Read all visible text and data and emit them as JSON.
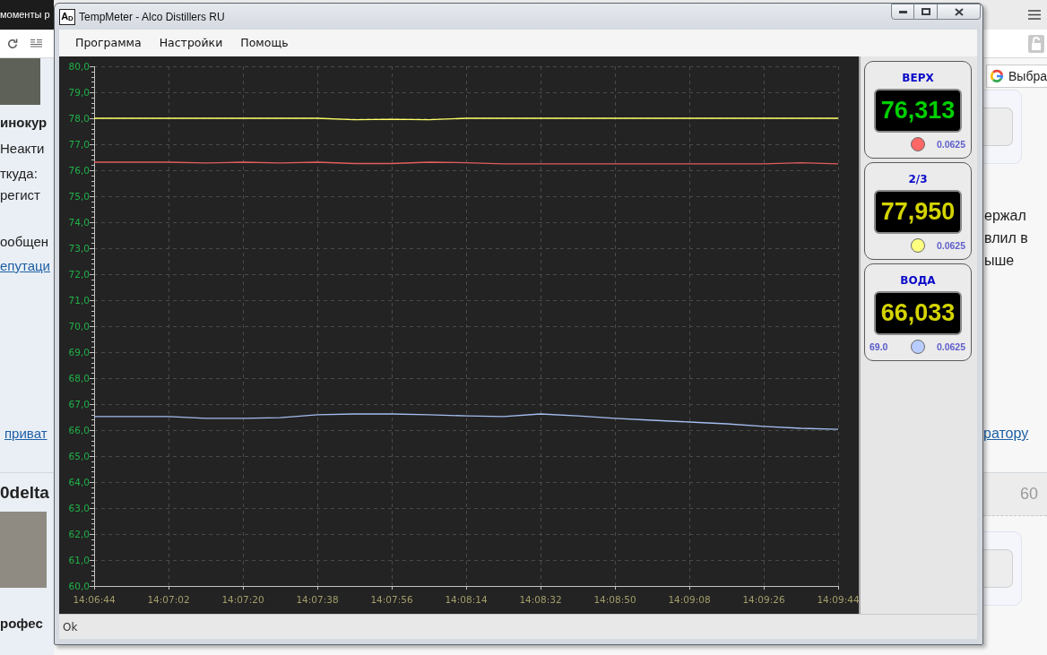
{
  "browser": {
    "tabs": [
      {
        "label": "моменты р",
        "selected": true
      }
    ],
    "translate_box": {
      "label": "Выбра"
    },
    "posts": [
      {
        "author": {
          "rank": "инокур",
          "status": "Неакти",
          "details": [
            "ткуда:",
            "регист"
          ],
          "posts_count": "ообщен",
          "reputation": "епутаци",
          "message_link": "приват"
        },
        "body": {
          "lines": [
            "ержал",
            "влил в",
            "ыше"
          ],
          "link": "ратору"
        }
      },
      {
        "author": {
          "name": "0delta",
          "rank": "рофес"
        },
        "header_number": "60"
      }
    ]
  },
  "window": {
    "icon_text": "A$_{D}$",
    "title": "TempMeter - Alco Distillers RU",
    "menu": [
      "Программа",
      "Настройки",
      "Помощь"
    ],
    "chart_data": {
      "type": "line",
      "grid": true,
      "categories": [
        "14:06:44",
        null,
        "14:07:02",
        null,
        "14:07:20",
        null,
        "14:07:38",
        null,
        "14:07:56",
        null,
        "14:08:14",
        null,
        "14:08:32",
        null,
        "14:08:50",
        null,
        "14:09:08",
        null,
        "14:09:26",
        null,
        "14:09:44"
      ],
      "series": [
        {
          "color": "#ffff66",
          "values": [
            78.0,
            78.0,
            78.0,
            78.0,
            78.0,
            78.0,
            78.0,
            77.94,
            77.96,
            77.94,
            78.0,
            78.0,
            78.0,
            78.0,
            78.0,
            78.0,
            78.0,
            78.0,
            78.0,
            78.0,
            78.0
          ]
        },
        {
          "color": "#e35d5d",
          "values": [
            76.31,
            76.31,
            76.31,
            76.28,
            76.31,
            76.28,
            76.31,
            76.26,
            76.26,
            76.31,
            76.29,
            76.25,
            76.25,
            76.25,
            76.25,
            76.25,
            76.25,
            76.25,
            76.25,
            76.29,
            76.25
          ]
        },
        {
          "color": "#a4bdf0",
          "values": [
            66.52,
            66.52,
            66.52,
            66.45,
            66.45,
            66.48,
            66.59,
            66.62,
            66.62,
            66.59,
            66.55,
            66.52,
            66.62,
            66.55,
            66.45,
            66.38,
            66.31,
            66.24,
            66.14,
            66.07,
            66.03
          ]
        }
      ],
      "ylim": [
        60,
        80
      ],
      "yticks": [
        {
          "value": 60,
          "label": "60,0"
        },
        {
          "value": 61,
          "label": "61,0"
        },
        {
          "value": 62,
          "label": "62,0"
        },
        {
          "value": 63,
          "label": "63,0"
        },
        {
          "value": 64,
          "label": "64,0"
        },
        {
          "value": 65,
          "label": "65,0"
        },
        {
          "value": 66,
          "label": "66,0"
        },
        {
          "value": 67,
          "label": "67,0"
        },
        {
          "value": 68,
          "label": "68,0"
        },
        {
          "value": 69,
          "label": "69,0"
        },
        {
          "value": 70,
          "label": "70,0"
        },
        {
          "value": 71,
          "label": "71,0"
        },
        {
          "value": 72,
          "label": "72,0"
        },
        {
          "value": 73,
          "label": "73,0"
        },
        {
          "value": 74,
          "label": "74,0"
        },
        {
          "value": 75,
          "label": "75,0"
        },
        {
          "value": 76,
          "label": "76,0"
        },
        {
          "value": 77,
          "label": "77,0"
        },
        {
          "value": 78,
          "label": "78,0"
        },
        {
          "value": 79,
          "label": "79,0"
        },
        {
          "value": 80,
          "label": "80,0"
        }
      ]
    },
    "sensors": [
      {
        "name": "ВЕРХ",
        "value": {
          "text": "76,313",
          "color": "#00d000"
        },
        "color": "#ff6666",
        "reading": "0.0625"
      },
      {
        "name": "2/3",
        "value": {
          "text": "77,950",
          "color": "#d4d400"
        },
        "color": "#ffff80",
        "reading": "0.0625"
      },
      {
        "name": "ВОДА",
        "value": {
          "text": "66,033",
          "color": "#d4d400"
        },
        "color": "#b8ccff",
        "reading": "0.0625",
        "limit": "69.0"
      }
    ],
    "status_bar": "Ok"
  }
}
